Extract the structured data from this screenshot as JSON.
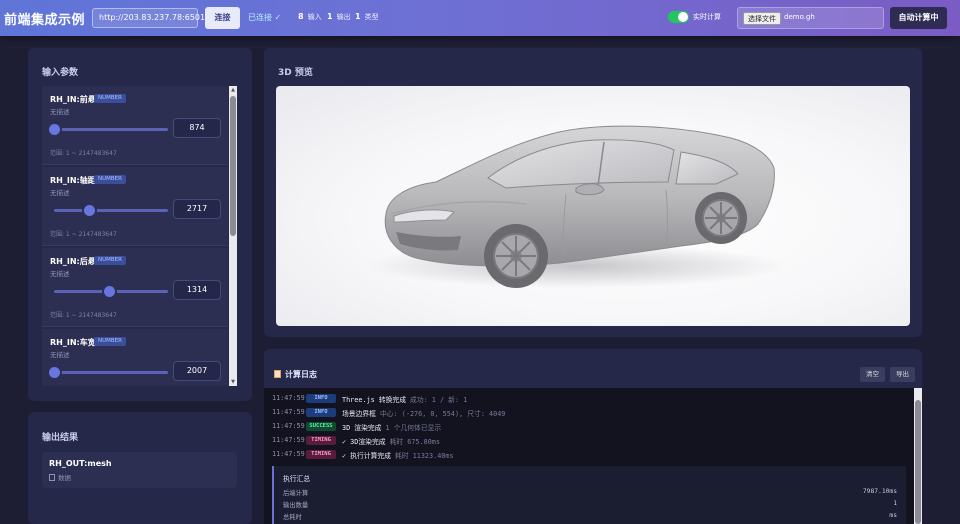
{
  "header": {
    "title": "前端集成示例",
    "server_url": "http://203.83.237.78:6501",
    "connect_label": "连接",
    "status": "已连接 ✓",
    "stats": [
      {
        "count": "8",
        "label": "输入"
      },
      {
        "count": "1",
        "label": "输出"
      },
      {
        "count": "1",
        "label": "类型"
      }
    ],
    "realtime_label": "实时计算",
    "realtime_enabled": true,
    "file_button": "选择文件",
    "file_name": "demo.gh",
    "auto_compute_label": "自动计算中"
  },
  "input_panel": {
    "title": "输入参数",
    "params": [
      {
        "name": "RH_IN:前悬",
        "type": "NUMBER",
        "desc": "无描述",
        "value": "874",
        "slider_fraction": 0.0,
        "range": "范围: 1 ~ 2147483647"
      },
      {
        "name": "RH_IN:轴距",
        "type": "NUMBER",
        "desc": "无描述",
        "value": "2717",
        "slider_fraction": 0.31,
        "range": "范围: 1 ~ 2147483647"
      },
      {
        "name": "RH_IN:后悬",
        "type": "NUMBER",
        "desc": "无描述",
        "value": "1314",
        "slider_fraction": 0.48,
        "range": "范围: 1 ~ 2147483647"
      },
      {
        "name": "RH_IN:车宽",
        "type": "NUMBER",
        "desc": "无描述",
        "value": "2007",
        "slider_fraction": 0.0,
        "range": ""
      }
    ]
  },
  "output_panel": {
    "title": "输出结果",
    "name": "RH_OUT:mesh",
    "type": "数据",
    "type_icon": "document-icon"
  },
  "preview": {
    "title": "3D 预览"
  },
  "log": {
    "title": "计算日志",
    "title_icon": "clipboard-icon",
    "clear_label": "清空",
    "export_label": "导出",
    "entries": [
      {
        "time": "11:47:59",
        "tag": "INFO",
        "msg": "Three.js 转换完成",
        "detail": "成功: 1 / 新: 1"
      },
      {
        "time": "11:47:59",
        "tag": "INFO",
        "msg": "场景边界框",
        "detail": "中心: (-276, 0, 554), 尺寸: 4049"
      },
      {
        "time": "11:47:59",
        "tag": "SUCCESS",
        "msg": "3D 渲染完成",
        "detail": "1 个几何体已显示"
      },
      {
        "time": "11:47:59",
        "tag": "TIMING",
        "msg": "✓ 3D渲染完成",
        "detail": "耗时 675.80ms"
      },
      {
        "time": "11:47:59",
        "tag": "TIMING",
        "msg": "✓ 执行计算完成",
        "detail": "耗时 11323.40ms"
      }
    ],
    "summary": {
      "title": "执行汇总",
      "rows": [
        {
          "label": "后端计算",
          "value": "7987.10ms"
        },
        {
          "label": "输出数量",
          "value": "1"
        },
        {
          "label": "总耗时",
          "value": "ms"
        }
      ]
    }
  },
  "colors": {
    "accent": "#6877e0",
    "success": "#22c55e",
    "panel": "#26284a",
    "background": "#1d1d33"
  }
}
